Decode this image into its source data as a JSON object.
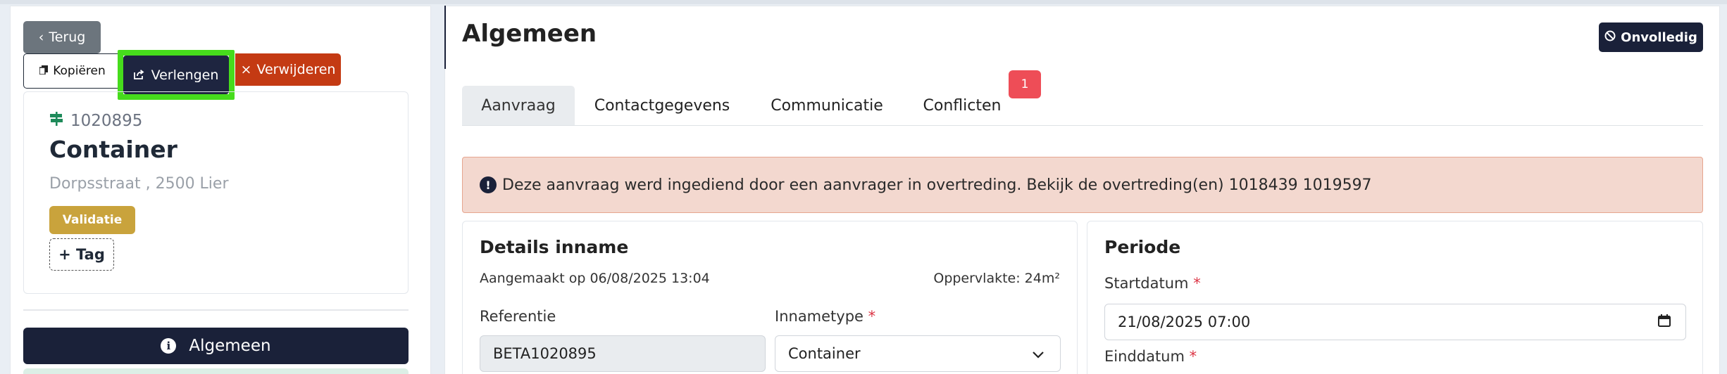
{
  "sidebar": {
    "back_label": "Terug",
    "copy_label": "Kopiëren",
    "extend_label": "Verlengen",
    "delete_label": "Verwijderen",
    "card": {
      "number": "1020895",
      "title": "Container",
      "address": "Dorpsstraat , 2500 Lier",
      "status_badge": "Validatie",
      "add_tag_label": "+ Tag"
    },
    "nav_active_label": "Algemeen"
  },
  "header": {
    "title": "Algemeen",
    "status_button": "Onvolledig"
  },
  "tabs": [
    {
      "label": "Aanvraag",
      "active": true
    },
    {
      "label": "Contactgegevens",
      "active": false
    },
    {
      "label": "Communicatie",
      "active": false
    },
    {
      "label": "Conflicten",
      "active": false,
      "badge": "1"
    }
  ],
  "alert": {
    "text": "Deze aanvraag werd ingediend door een aanvrager in overtreding. Bekijk de overtreding(en) 1018439 1019597"
  },
  "details": {
    "title": "Details inname",
    "created": "Aangemaakt op 06/08/2025 13:04",
    "area": "Oppervlakte: 24m²",
    "reference_label": "Referentie",
    "reference_value": "BETA1020895",
    "type_label": "Innametype",
    "type_value": "Container",
    "required_mark": "*"
  },
  "period": {
    "title": "Periode",
    "start_label": "Startdatum",
    "start_value": "21/08/2025 07:00",
    "end_label": "Einddatum",
    "required_mark": "*"
  },
  "colors": {
    "navy": "#1a2139",
    "highlight": "#46dc1c",
    "danger": "#c43a13",
    "validation": "#c9a33c",
    "alert_bg": "#f3d8cf",
    "badge_red": "#ee4d57"
  }
}
